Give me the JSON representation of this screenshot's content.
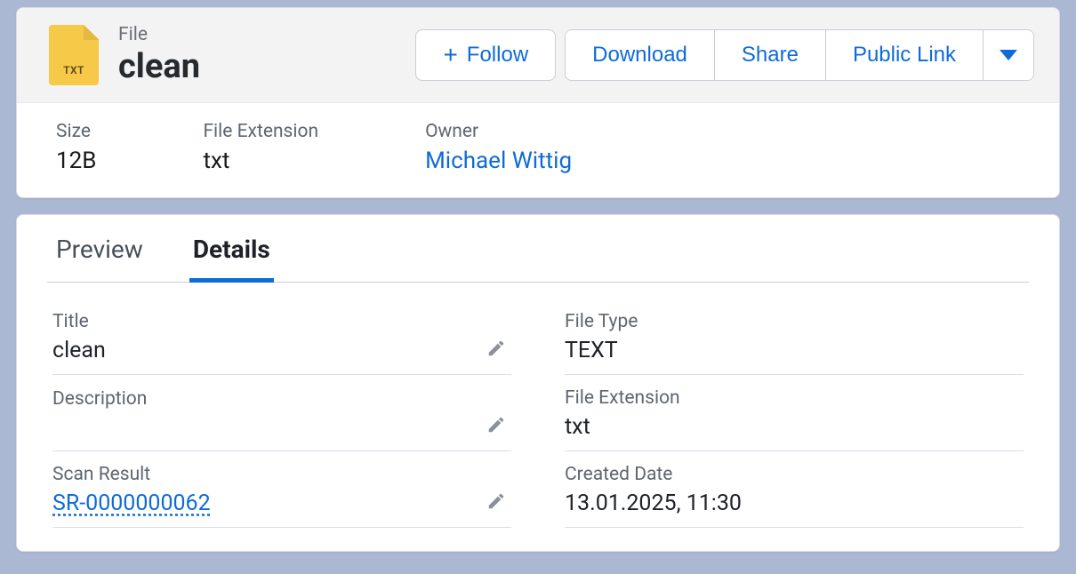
{
  "header": {
    "eyebrow": "File",
    "title": "clean",
    "file_icon_badge": "TXT",
    "actions": {
      "follow": "Follow",
      "download": "Download",
      "share": "Share",
      "public_link": "Public Link"
    },
    "meta": {
      "size_label": "Size",
      "size_value": "12B",
      "ext_label": "File Extension",
      "ext_value": "txt",
      "owner_label": "Owner",
      "owner_value": "Michael Wittig"
    }
  },
  "tabs": {
    "preview": "Preview",
    "details": "Details"
  },
  "details": {
    "title": {
      "label": "Title",
      "value": "clean"
    },
    "description": {
      "label": "Description",
      "value": ""
    },
    "scan_result": {
      "label": "Scan Result",
      "value": "SR-0000000062"
    },
    "file_type": {
      "label": "File Type",
      "value": "TEXT"
    },
    "file_extension": {
      "label": "File Extension",
      "value": "txt"
    },
    "created_date": {
      "label": "Created Date",
      "value": "13.01.2025, 11:30"
    }
  }
}
